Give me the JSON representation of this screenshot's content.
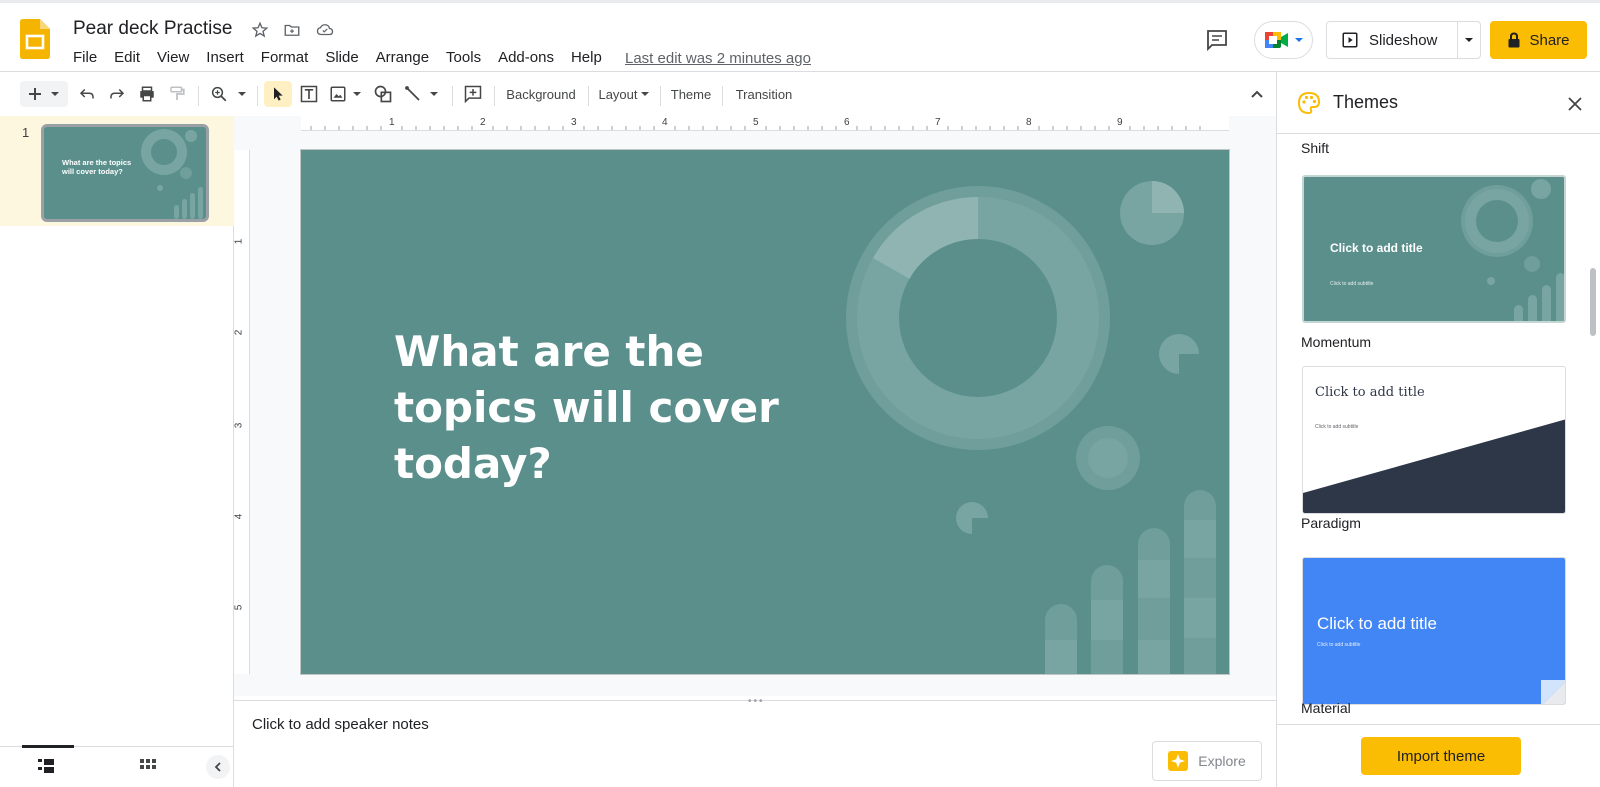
{
  "doc": {
    "title": "Pear deck Practise",
    "last_edit": "Last edit was 2 minutes ago"
  },
  "menu": [
    "File",
    "Edit",
    "View",
    "Insert",
    "Format",
    "Slide",
    "Arrange",
    "Tools",
    "Add-ons",
    "Help"
  ],
  "header": {
    "slideshow_label": "Slideshow",
    "share_label": "Share"
  },
  "toolbar": {
    "background_label": "Background",
    "layout_label": "Layout",
    "theme_label": "Theme",
    "transition_label": "Transition"
  },
  "rulers": {
    "horizontal": [
      "1",
      "2",
      "3",
      "4",
      "5",
      "6",
      "7",
      "8",
      "9"
    ],
    "vertical": [
      "1",
      "2",
      "3",
      "4",
      "5"
    ]
  },
  "filmstrip": {
    "slide_number": "1",
    "thumb_title": "What are the topics will cover today?"
  },
  "slide": {
    "title_line1": "What are the",
    "title_line2": "topics will cover",
    "title_line3": "today?"
  },
  "notes": {
    "placeholder": "Click to add speaker notes",
    "explore_label": "Explore"
  },
  "themes_panel": {
    "title": "Themes",
    "themes": [
      {
        "name": "Shift"
      },
      {
        "name": "Momentum",
        "card_title": "Click to add title",
        "card_subtitle": "Click to add subtitle"
      },
      {
        "name": "Paradigm",
        "card_title": "Click to add title",
        "card_subtitle": "Click to add subtitle"
      },
      {
        "name": "Material",
        "card_title": "Click to add title",
        "card_subtitle": "Click to add subtitle"
      }
    ],
    "import_label": "Import theme"
  },
  "colors": {
    "slide_bg": "#5a8f8c",
    "accent": "#fbbc04",
    "material_bg": "#4285f4",
    "paradigm_dark": "#2d3748"
  }
}
